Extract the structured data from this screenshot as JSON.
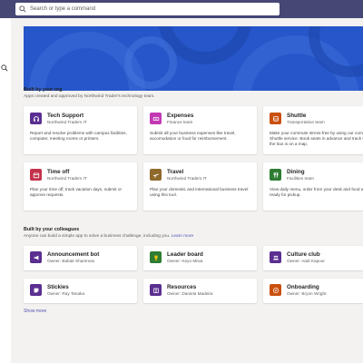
{
  "search": {
    "placeholder": "Search or type a command"
  },
  "colors": {
    "topbar": "#464775",
    "banner": "#2656c9",
    "purple": "#5b2f91",
    "pink": "#c239b3",
    "orange": "#ca5010",
    "red": "#c4314b",
    "brown": "#8f6a2c",
    "green": "#2e7d32",
    "link": "#4f52b2"
  },
  "org": {
    "title": "Built by your org",
    "subtitle": "Apps created and approved by Northwind Trader's technology team.",
    "cards": [
      {
        "name": "Tech Support",
        "sub": "Northwind Traders IT",
        "desc": "Report and resolve problems with campus facilities, computer, meeting rooms or printers.",
        "icon": "headset-icon"
      },
      {
        "name": "Expenses",
        "sub": "Finance team",
        "desc": "Submit all your business expenses like travel, accomodation or food for reimbursement.",
        "icon": "receipt-icon"
      },
      {
        "name": "Shuttle",
        "sub": "Transportation team",
        "desc": "Make your commute stress-free by using our company Shuttle service. Book seats in advance and track where the bus is on a map.",
        "icon": "bus-icon"
      },
      {
        "name": "Time off",
        "sub": "Northwind Traders IT",
        "desc": "Plan your time off, track vacation days, submit or approve requests.",
        "icon": "calendar-icon"
      },
      {
        "name": "Travel",
        "sub": "Northwind Traders IT",
        "desc": "Plan your domestic and international business travel using this tool.",
        "icon": "airplane-icon"
      },
      {
        "name": "Dining",
        "sub": "Facilities team",
        "desc": "View daily menu, order from your desk and food will be ready for pickup.",
        "icon": "fork-knife-icon"
      }
    ]
  },
  "colleagues": {
    "title": "Built by your colleagues",
    "subtitle": "Anyone can build a simple app to solve a business challenge, including you.",
    "learn_more": "Learn more",
    "cards": [
      {
        "name": "Announcement bot",
        "sub": "Owner: Babak Shammas",
        "icon": "megaphone-icon"
      },
      {
        "name": "Leader board",
        "sub": "Owner: Keyo Miwa",
        "icon": "trophy-icon"
      },
      {
        "name": "Culture club",
        "sub": "Owner: Aadi Kapoor",
        "icon": "people-icon"
      },
      {
        "name": "Stickies",
        "sub": "Owner: Ray Tanaka",
        "icon": "sticky-note-icon"
      },
      {
        "name": "Resources",
        "sub": "Owner: Daniela Madeira",
        "icon": "book-icon"
      },
      {
        "name": "Onboarding",
        "sub": "Owner: Bryon Wright",
        "icon": "compass-icon"
      }
    ]
  },
  "show_more": "Show more"
}
